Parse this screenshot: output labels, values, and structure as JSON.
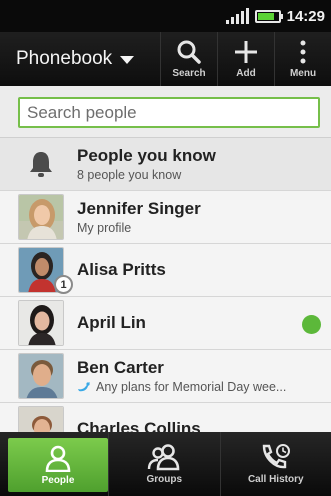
{
  "status_bar": {
    "time": "14:29",
    "battery_level": 0.8
  },
  "action_bar": {
    "title": "Phonebook",
    "actions": [
      {
        "label": "Search",
        "icon": "search-icon"
      },
      {
        "label": "Add",
        "icon": "add-icon"
      },
      {
        "label": "Menu",
        "icon": "overflow-menu-icon"
      }
    ]
  },
  "search": {
    "placeholder": "Search people",
    "value": ""
  },
  "people_you_know": {
    "title": "People you know",
    "subtitle": "8 people you know"
  },
  "contacts": [
    {
      "name": "Jennifer Singer",
      "subtitle": "My profile"
    },
    {
      "name": "Alisa Pritts",
      "badge": "1"
    },
    {
      "name": "April Lin",
      "status": "online"
    },
    {
      "name": "Ben Carter",
      "subtitle": "Any plans for Memorial Day wee..."
    },
    {
      "name": "Charles Collins"
    }
  ],
  "bottom_nav": [
    {
      "label": "People",
      "icon": "person-icon",
      "active": true
    },
    {
      "label": "Groups",
      "icon": "group-icon",
      "active": false
    },
    {
      "label": "Call History",
      "icon": "call-history-icon",
      "active": false
    }
  ],
  "colors": {
    "accent": "#76bf4a",
    "online": "#5cb83a",
    "battery": "#5bd234"
  }
}
